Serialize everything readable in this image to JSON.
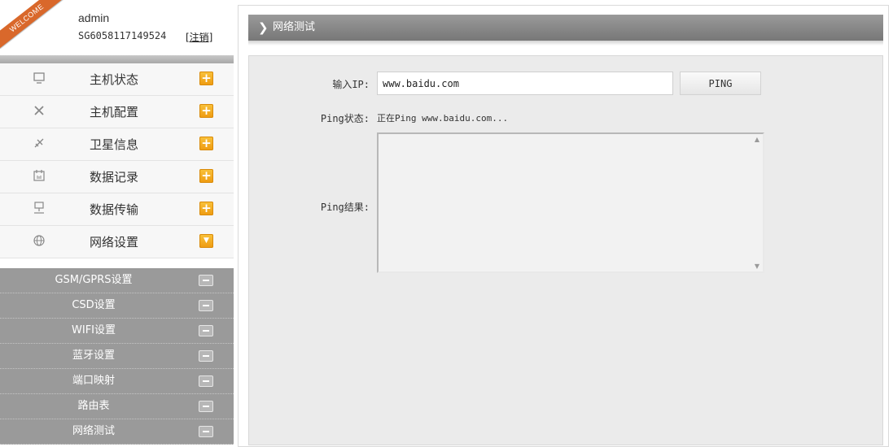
{
  "user": {
    "welcome": "WELCOME",
    "name": "admin",
    "device_id": "SG6058117149524",
    "logout": "[注销]"
  },
  "menu": {
    "items": [
      {
        "label": "主机状态",
        "icon": "monitor-icon",
        "toggle": "+"
      },
      {
        "label": "主机配置",
        "icon": "tools-icon",
        "toggle": "+"
      },
      {
        "label": "卫星信息",
        "icon": "satellite-icon",
        "toggle": "+"
      },
      {
        "label": "数据记录",
        "icon": "calendar-icon",
        "toggle": "+"
      },
      {
        "label": "数据传输",
        "icon": "network-icon",
        "toggle": "+"
      },
      {
        "label": "网络设置",
        "icon": "globe-icon",
        "toggle": "▼",
        "expanded": true
      }
    ],
    "subitems": [
      {
        "label": "GSM/GPRS设置"
      },
      {
        "label": "CSD设置"
      },
      {
        "label": "WIFI设置"
      },
      {
        "label": "蓝牙设置"
      },
      {
        "label": "端口映射"
      },
      {
        "label": "路由表"
      },
      {
        "label": "网络测试"
      }
    ]
  },
  "header": {
    "title": "网络测试"
  },
  "form": {
    "ip_label": "输入IP:",
    "ip_value": "www.baidu.com",
    "ping_button": "PING",
    "status_label": "Ping状态:",
    "status_value": "正在Ping www.baidu.com...",
    "result_label": "Ping结果:",
    "result_value": ""
  },
  "colors": {
    "accent_orange": "#f0a020",
    "submenu_gray": "#9a9a9a",
    "header_gray": "#888888",
    "ribbon": "#d9682b"
  }
}
